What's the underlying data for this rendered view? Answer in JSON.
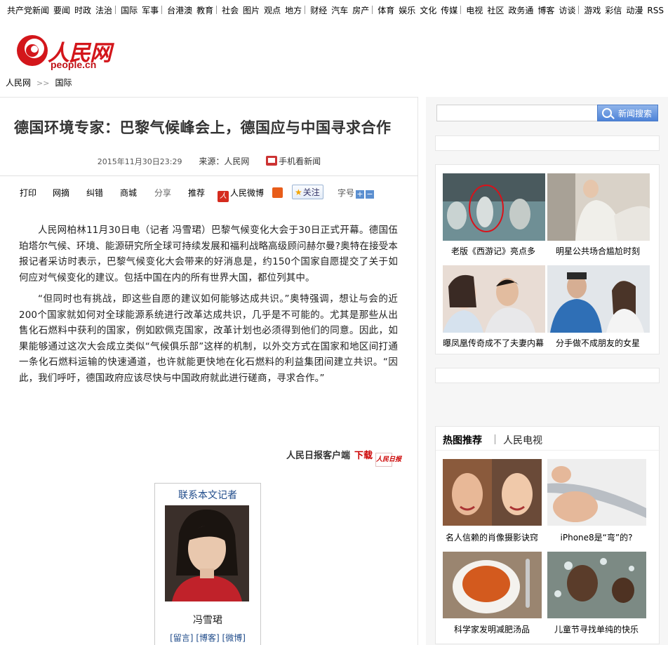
{
  "topnav": {
    "groups": [
      [
        "共产党新闻",
        "要闻",
        "时政",
        "法治"
      ],
      [
        "国际",
        "军事"
      ],
      [
        "台港澳",
        "教育"
      ],
      [
        "社会",
        "图片",
        "观点",
        "地方"
      ],
      [
        "财经",
        "汽车",
        "房产"
      ],
      [
        "体育",
        "娱乐",
        "文化",
        "传媒"
      ],
      [
        "电视",
        "社区",
        "政务通",
        "博客",
        "访谈"
      ],
      [
        "游戏",
        "彩信",
        "动漫",
        "RSS"
      ]
    ]
  },
  "logo": {
    "cn": "人民网",
    "en": "people.cn"
  },
  "breadcrumb": {
    "home": "人民网",
    "arrow": ">>",
    "section": "国际"
  },
  "article": {
    "title": "德国环境专家：巴黎气候峰会上，德国应与中国寻求合作",
    "date": "2015年11月30日23:29",
    "source": "来源：人民网",
    "mobile": "手机看新闻",
    "paragraphs": [
      "人民网柏林11月30日电（记者 冯雪珺）巴黎气候变化大会于30日正式开幕。德国伍珀塔尔气候、环境、能源研究所全球可持续发展和福利战略高级顾问赫尔曼?奥特在接受本报记者采访时表示，巴黎气候变化大会带来的好消息是，约150个国家自愿提交了关于如何应对气候变化的建议。包括中国在内的所有世界大国，都位列其中。",
      "“但同时也有挑战，即这些自愿的建议如何能够达成共识。”奥特强调，想让与会的近200个国家就如何对全球能源系统进行改革达成共识，几乎是不可能的。尤其是那些从出售化石燃料中获利的国家，例如欧佩克国家，改革计划也必须得到他们的同意。因此，如果能够通过这次大会成立类似“气候俱乐部”这样的机制，以外交方式在国家和地区间打通一条化石燃料运输的快速通道，也许就能更快地在化石燃料的利益集团间建立共识。“因此，我们呼吁，德国政府应该尽快与中国政府就此进行磋商，寻求合作。”"
    ]
  },
  "tools": {
    "print": "打印",
    "collect": "网摘",
    "error": "纠错",
    "mall": "商城",
    "share": "分享",
    "recommend": "推荐",
    "weibo": "人民微博",
    "follow": "关注",
    "fontsize": "字号",
    "plus": "+",
    "minus": "−",
    "weibo_icon": "人"
  },
  "app": {
    "label": "人民日报客户端",
    "download": "下载",
    "icon_text": "人民日报"
  },
  "reporter": {
    "title": "联系本文记者",
    "name": "冯雪珺",
    "links": [
      "[留言]",
      "[博客]",
      "[微博]"
    ]
  },
  "search": {
    "placeholder": "",
    "button": "新闻搜索"
  },
  "pics": [
    {
      "caption": "老版《西游记》亮点多"
    },
    {
      "caption": "明星公共场合尴尬时刻"
    },
    {
      "caption": "曝凤凰传奇成不了夫妻内幕"
    },
    {
      "caption": "分手做不成朋友的女星"
    }
  ],
  "hot": {
    "tab1": "热图推荐",
    "tab2": "人民电视",
    "items": [
      {
        "caption": "名人信赖的肖像摄影诀窍"
      },
      {
        "caption": "iPhone8是“弯”的?"
      },
      {
        "caption": "科学家发明减肥汤品"
      },
      {
        "caption": "儿童节寻找单纯的快乐"
      }
    ]
  },
  "colors": {
    "brand_red": "#d3161b",
    "link_blue": "#1f4b8a",
    "search_blue": "#4d83d8"
  }
}
